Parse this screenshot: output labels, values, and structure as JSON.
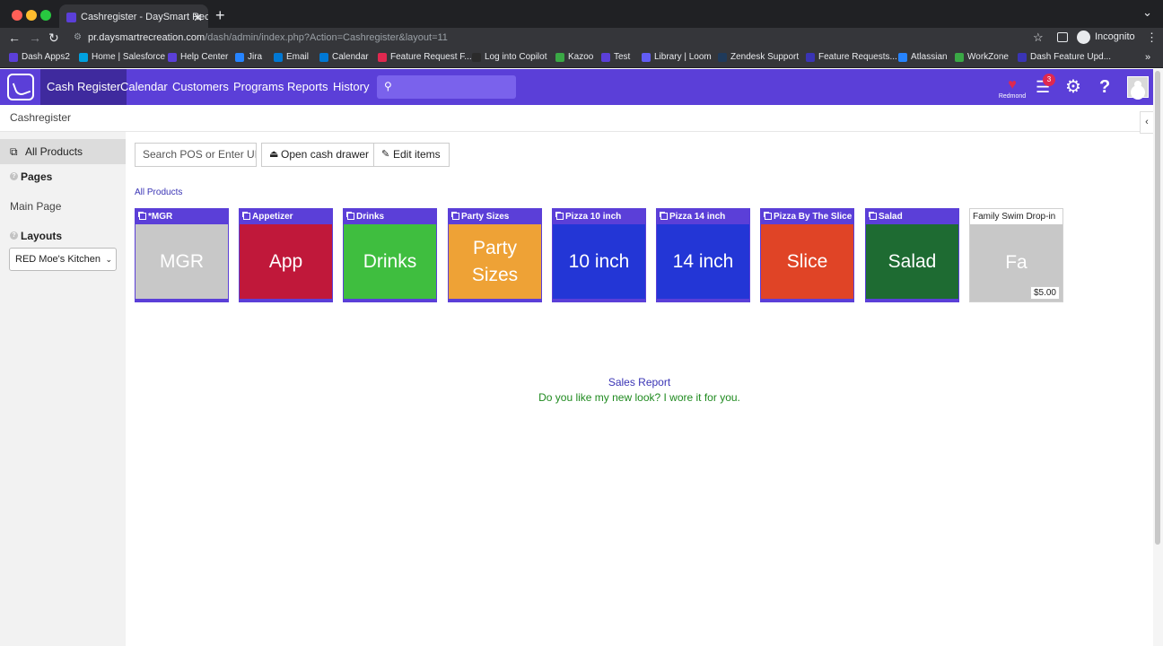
{
  "browser": {
    "tab_title": "Cashregister - DaySmart Rec",
    "tab_close": "✕",
    "new_tab": "+",
    "url_host": "pr.daysmartrecreation.com",
    "url_path": "/dash/admin/index.php?Action=Cashregister&layout=11",
    "incognito_label": "Incognito",
    "bookmarks": [
      {
        "label": "Dash Apps2",
        "color": "#5b3fd8"
      },
      {
        "label": "Home | Salesforce",
        "color": "#00a1e0"
      },
      {
        "label": "Help Center",
        "color": "#5b3fd8"
      },
      {
        "label": "Jira",
        "color": "#2684ff"
      },
      {
        "label": "Email",
        "color": "#0078d4"
      },
      {
        "label": "Calendar",
        "color": "#0078d4"
      },
      {
        "label": "Feature Request F...",
        "color": "#e0284f"
      },
      {
        "label": "Log into Copilot",
        "color": "#2b2b2b"
      },
      {
        "label": "Kazoo",
        "color": "#3aa845"
      },
      {
        "label": "Test",
        "color": "#5b3fd8"
      },
      {
        "label": "Library | Loom",
        "color": "#625df5"
      },
      {
        "label": "Zendesk Support",
        "color": "#1f3a5a"
      },
      {
        "label": "Feature Requests...",
        "color": "#3a34b5"
      },
      {
        "label": "Atlassian",
        "color": "#2684ff"
      },
      {
        "label": "WorkZone",
        "color": "#3aa845"
      },
      {
        "label": "Dash Feature Upd...",
        "color": "#3a34b5"
      }
    ],
    "bookmarks_more": "»"
  },
  "header": {
    "nav": [
      "Cash Register",
      "Calendar",
      "Customers",
      "Programs",
      "Reports",
      "History"
    ],
    "location": "Redmond",
    "tasks_badge": "3",
    "help": "?"
  },
  "breadcrumb": "Cashregister",
  "sidebar": {
    "all_products": "All Products",
    "pages_heading": "Pages",
    "main_page": "Main Page",
    "layouts_heading": "Layouts",
    "layout_selected": "RED Moe's Kitchen"
  },
  "toolbar": {
    "search_placeholder": "Search POS or Enter UPC",
    "open_cash_drawer": "Open cash drawer",
    "edit_items": "Edit items"
  },
  "all_products_link": "All Products",
  "categories": [
    {
      "name": "*MGR",
      "label": "MGR",
      "color": "#c8c8c8"
    },
    {
      "name": "Appetizer",
      "label": "App",
      "color": "#c0183a"
    },
    {
      "name": "Drinks",
      "label": "Drinks",
      "color": "#3fbe3f"
    },
    {
      "name": "Party Sizes",
      "label": "Party Sizes",
      "color": "#eea236"
    },
    {
      "name": "Pizza 10 inch",
      "label": "10 inch",
      "color": "#2336d6"
    },
    {
      "name": "Pizza 14 inch",
      "label": "14 inch",
      "color": "#2336d6"
    },
    {
      "name": "Pizza By The Slice",
      "label": "Slice",
      "color": "#e04426"
    },
    {
      "name": "Salad",
      "label": "Salad",
      "color": "#1e6b32"
    }
  ],
  "item": {
    "name": "Family Swim Drop-in",
    "label": "Fa",
    "price": "$5.00",
    "color": "#c8c8c8"
  },
  "footer": {
    "sales_report": "Sales Report",
    "tagline": "Do you like my new look? I wore it for you."
  }
}
